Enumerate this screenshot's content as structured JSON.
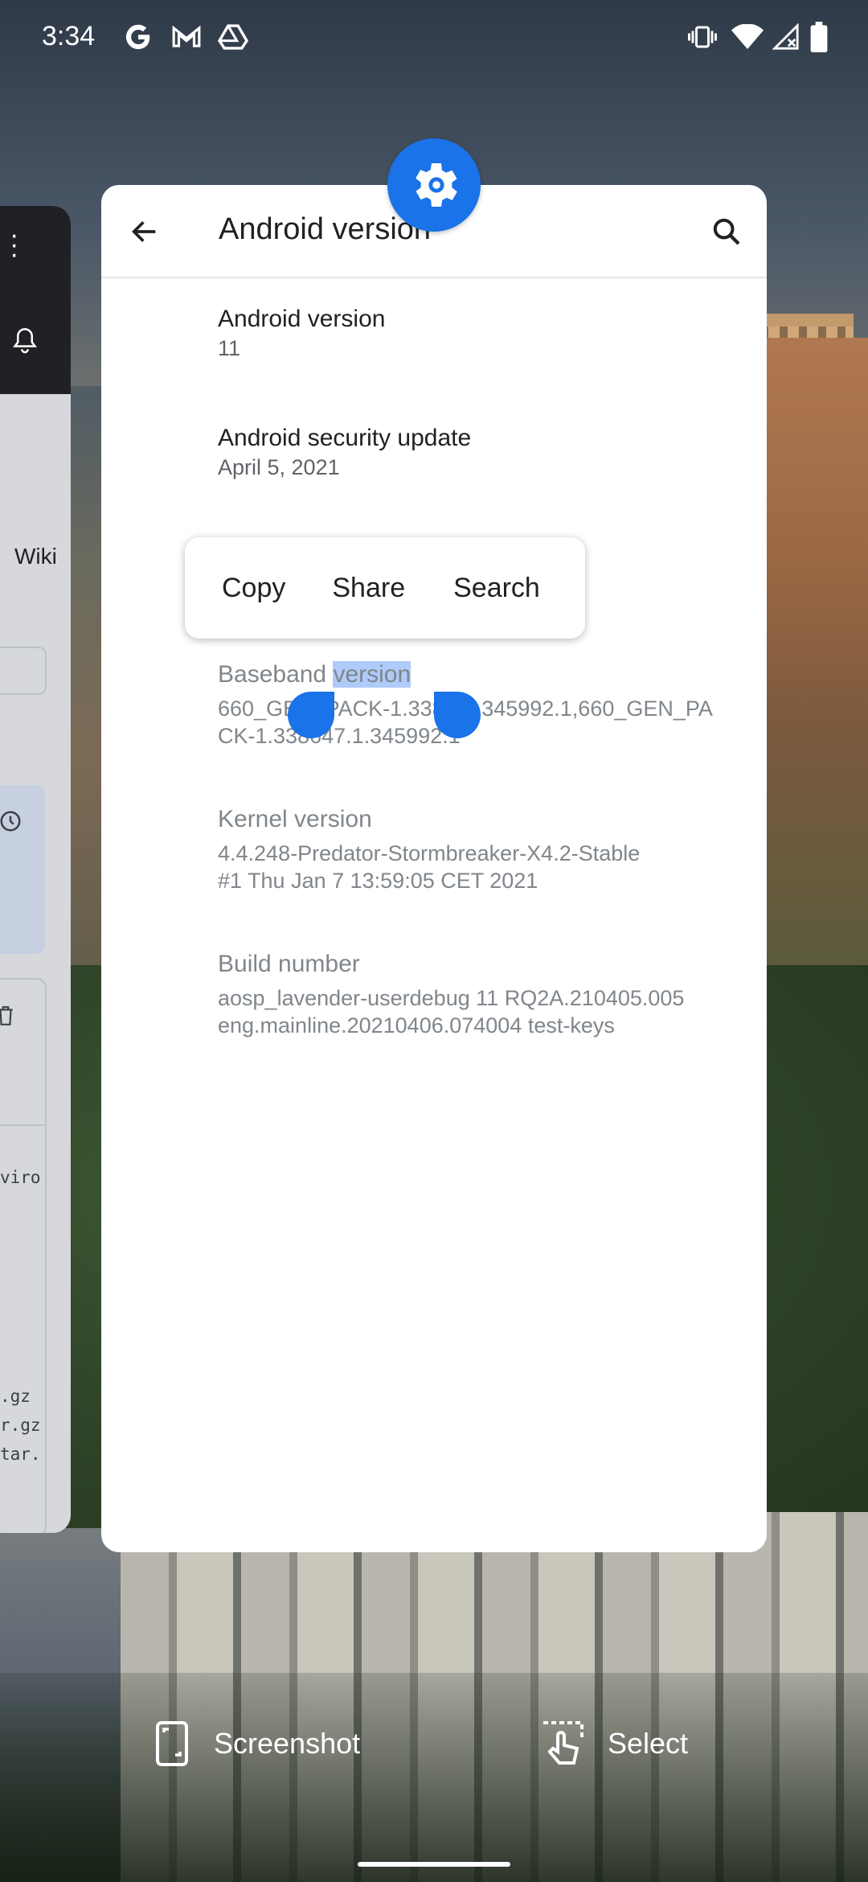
{
  "status_bar": {
    "time": "3:34",
    "notification_icons": [
      "google-icon",
      "gmail-icon",
      "drive-icon"
    ],
    "system_icons": [
      "vibrate-icon",
      "wifi-icon",
      "signal-icon",
      "battery-icon"
    ]
  },
  "left_card": {
    "wiki_label": "Wiki",
    "code_lines": [
      "viro",
      ".gz",
      "r.gz",
      "tar."
    ]
  },
  "settings": {
    "app_icon": "gear-icon",
    "title": "Android version",
    "items": [
      {
        "title": "Android version",
        "value": "11"
      },
      {
        "title": "Android security update",
        "value": "April 5, 2021"
      },
      {
        "title_pre": "Baseband ",
        "title_selected": "version",
        "value_line1": "660_GEN_PACK-1.338",
        "value_line1b": "1.345992.1,660_GEN_PA",
        "value_line2": "CK-1.338647.1.345992.1"
      },
      {
        "title": "Kernel version",
        "value_line1": "4.4.248-Predator-Stormbreaker-X4.2-Stable",
        "value_line2": "#1 Thu Jan 7 13:59:05 CET 2021"
      },
      {
        "title": "Build number",
        "value_line1": "aosp_lavender-userdebug 11 RQ2A.210405.005",
        "value_line2": "eng.mainline.20210406.074004 test-keys"
      }
    ]
  },
  "context_menu": {
    "copy": "Copy",
    "share": "Share",
    "search": "Search"
  },
  "recents_actions": {
    "screenshot": "Screenshot",
    "select": "Select"
  },
  "colors": {
    "accent": "#1a73e8",
    "selection": "#aecbfa"
  }
}
